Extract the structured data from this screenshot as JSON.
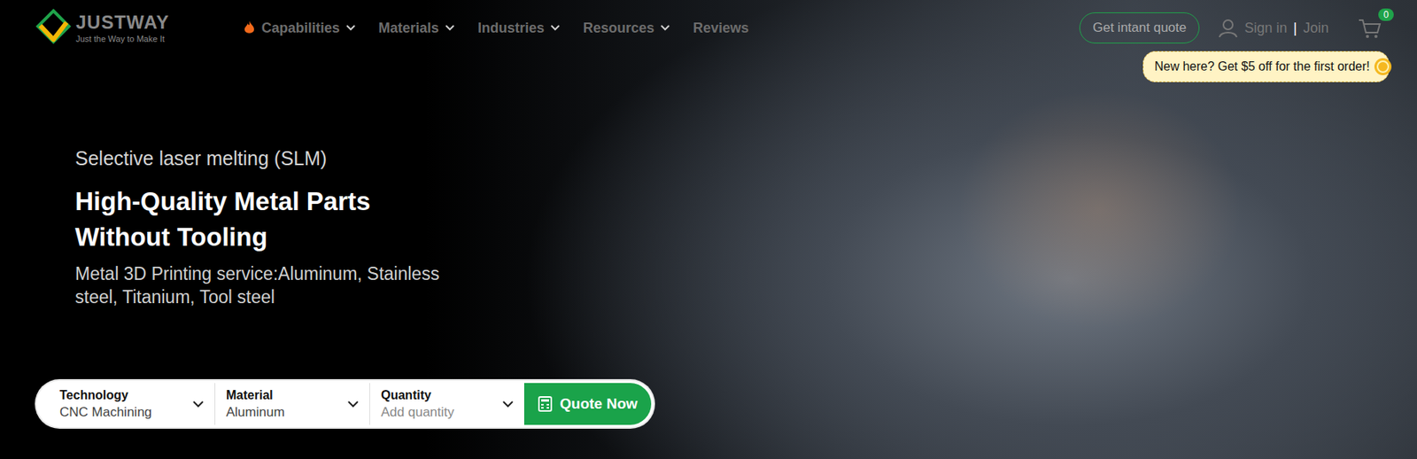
{
  "logo": {
    "name": "JUSTWAY",
    "tagline": "Just the Way to Make It"
  },
  "nav": [
    {
      "label": "Capabilities",
      "has_menu": true,
      "hot": true
    },
    {
      "label": "Materials",
      "has_menu": true,
      "hot": false
    },
    {
      "label": "Industries",
      "has_menu": true,
      "hot": false
    },
    {
      "label": "Resources",
      "has_menu": true,
      "hot": false
    },
    {
      "label": "Reviews",
      "has_menu": false,
      "hot": false
    }
  ],
  "quote_link": "Get intant quote",
  "account": {
    "sign_in": "Sign in",
    "separator": "|",
    "join": "Join"
  },
  "cart": {
    "count": "0"
  },
  "promo": "New here? Get $5 off for the first order!",
  "hero": {
    "eyebrow": "Selective laser melting (SLM)",
    "title_lines": [
      "High-Quality Metal Parts",
      "Without Tooling"
    ],
    "description": "Metal 3D Printing service:Aluminum, Stainless steel, Titanium, Tool steel"
  },
  "quote_form": {
    "fields": [
      {
        "label": "Technology",
        "value": "CNC Machining",
        "is_placeholder": false
      },
      {
        "label": "Material",
        "value": "Aluminum",
        "is_placeholder": false
      },
      {
        "label": "Quantity",
        "value": "Add quantity",
        "is_placeholder": true
      }
    ],
    "button": "Quote Now"
  }
}
